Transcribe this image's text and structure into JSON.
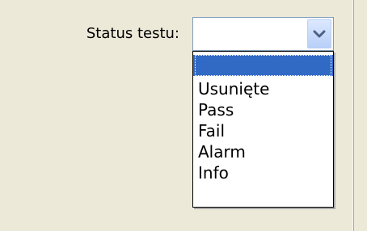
{
  "form": {
    "status_label": "Status testu:"
  },
  "status_select": {
    "value": ""
  },
  "dropdown": {
    "options": [
      "",
      "Usunięte",
      "Pass",
      "Fail",
      "Alarm",
      "Info"
    ],
    "selected_index": 0
  },
  "colors": {
    "background": "#ece9d8",
    "selected_option": "#316ac5",
    "select_border": "#7f9db9",
    "dropdown_border": "#000000"
  },
  "icons": {
    "dropdown_button": "chevron-down-icon"
  }
}
